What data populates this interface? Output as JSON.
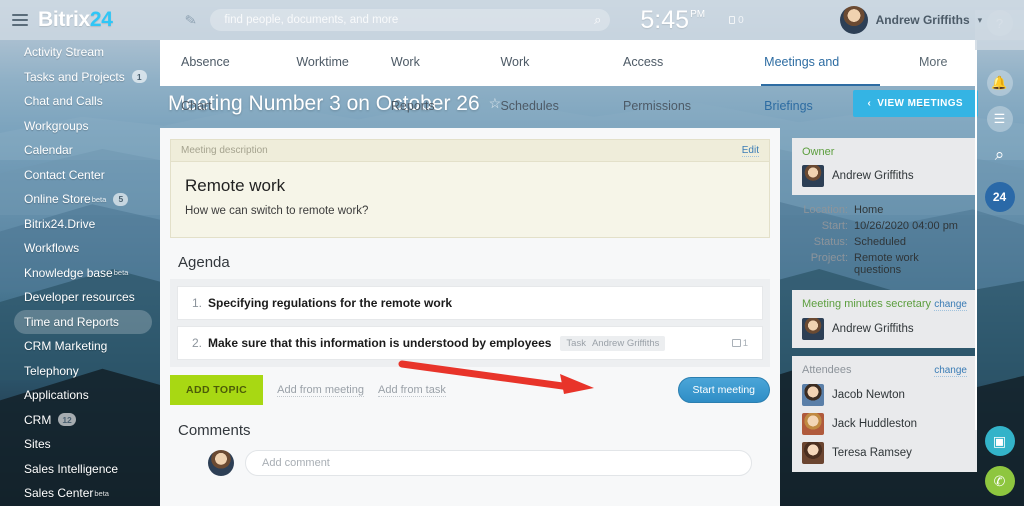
{
  "header": {
    "logo_text": "Bitrix",
    "logo_accent": "24",
    "menu_icon": "hamburger-icon",
    "compose_icon": "pencil-icon",
    "search_placeholder": "find people, documents, and more",
    "search_value": "",
    "search_icon": "search-icon",
    "clock_time": "5:45",
    "clock_meridiem": "PM",
    "timer_value": "0",
    "user_name": "Andrew Griffiths",
    "user_caret": "▾"
  },
  "sidebar": {
    "items": [
      {
        "label": "Activity Stream",
        "beta": "",
        "count": "",
        "active": false
      },
      {
        "label": "Tasks and Projects",
        "beta": "",
        "count": "1",
        "active": false
      },
      {
        "label": "Chat and Calls",
        "beta": "",
        "count": "",
        "active": false
      },
      {
        "label": "Workgroups",
        "beta": "",
        "count": "",
        "active": false
      },
      {
        "label": "Calendar",
        "beta": "",
        "count": "",
        "active": false
      },
      {
        "label": "Contact Center",
        "beta": "",
        "count": "",
        "active": false
      },
      {
        "label": "Online Store",
        "beta": "beta",
        "count": "5",
        "active": false
      },
      {
        "label": "Bitrix24.Drive",
        "beta": "",
        "count": "",
        "active": false
      },
      {
        "label": "Workflows",
        "beta": "",
        "count": "",
        "active": false
      },
      {
        "label": "Knowledge base",
        "beta": "beta",
        "count": "",
        "active": false
      },
      {
        "label": "Developer resources",
        "beta": "",
        "count": "",
        "active": false
      },
      {
        "label": "Time and Reports",
        "beta": "",
        "count": "",
        "active": true
      },
      {
        "label": "CRM Marketing",
        "beta": "",
        "count": "",
        "active": false
      },
      {
        "label": "Telephony",
        "beta": "",
        "count": "",
        "active": false
      },
      {
        "label": "Applications",
        "beta": "",
        "count": "",
        "active": false
      },
      {
        "label": "CRM",
        "beta": "",
        "count": "12",
        "active": false
      },
      {
        "label": "Sites",
        "beta": "",
        "count": "",
        "active": false
      },
      {
        "label": "Sales Intelligence",
        "beta": "",
        "count": "",
        "active": false
      },
      {
        "label": "Sales Center",
        "beta": "beta",
        "count": "",
        "active": false
      }
    ]
  },
  "tabs": {
    "items": [
      {
        "label": "Absence Chart",
        "active": false
      },
      {
        "label": "Worktime",
        "active": false
      },
      {
        "label": "Work Reports",
        "active": false
      },
      {
        "label": "Work Schedules",
        "active": false
      },
      {
        "label": "Access Permissions",
        "active": false
      },
      {
        "label": "Meetings and Briefings",
        "active": true
      }
    ],
    "more_label": "More -"
  },
  "page": {
    "title": "Meeting Number 3 on October 26",
    "star_icon": "star-outline-icon",
    "view_meetings_label": "VIEW MEETINGS",
    "view_meetings_chevron": "‹"
  },
  "description": {
    "panel_label": "Meeting description",
    "edit_label": "Edit",
    "heading": "Remote work",
    "body": "How we can switch to remote work?"
  },
  "agenda": {
    "section_title": "Agenda",
    "items": [
      {
        "number": "1.",
        "text": "Specifying regulations for the remote work",
        "chip_type": "",
        "chip_user": "",
        "comment_count": ""
      },
      {
        "number": "2.",
        "text": "Make sure that this information is understood by employees",
        "chip_type": "Task",
        "chip_user": "Andrew Griffiths",
        "comment_count": "1"
      }
    ]
  },
  "actions": {
    "add_topic_label": "ADD TOPIC",
    "add_from_meeting_label": "Add from meeting",
    "add_from_task_label": "Add from task",
    "start_meeting_label": "Start meeting"
  },
  "comments": {
    "section_title": "Comments",
    "placeholder": "Add comment",
    "value": ""
  },
  "info": {
    "owner": {
      "title": "Owner",
      "name": "Andrew Griffiths"
    },
    "meta": [
      {
        "key": "Location:",
        "value": "Home"
      },
      {
        "key": "Start:",
        "value": "10/26/2020 04:00 pm"
      },
      {
        "key": "Status:",
        "value": "Scheduled"
      },
      {
        "key": "Project:",
        "value": "Remote work questions"
      }
    ],
    "secretary": {
      "title": "Meeting minutes secretary",
      "change_label": "change",
      "name": "Andrew Griffiths"
    },
    "attendees": {
      "title": "Attendees",
      "change_label": "change",
      "people": [
        "Jacob Newton",
        "Jack Huddleston",
        "Teresa Ramsey"
      ]
    }
  },
  "rail": {
    "help_icon": "question-mark-icon",
    "help_glyph": "?",
    "notifications_icon": "bell-icon",
    "notifications_glyph": "🔔",
    "chat_icon": "chat-bubble-icon",
    "chat_glyph": "☰",
    "search_icon": "search-icon",
    "search_glyph": "⌕",
    "badge_label": "24",
    "desktop_icon": "desktop-app-icon",
    "desktop_glyph": "▣",
    "call_icon": "phone-icon",
    "call_glyph": "✆"
  },
  "colors": {
    "accent_blue": "#2d6ca2",
    "button_blue": "#34b4e4",
    "green": "#a8d813",
    "owner_green": "#5c9e3e",
    "arrow_red": "#e8342a"
  }
}
